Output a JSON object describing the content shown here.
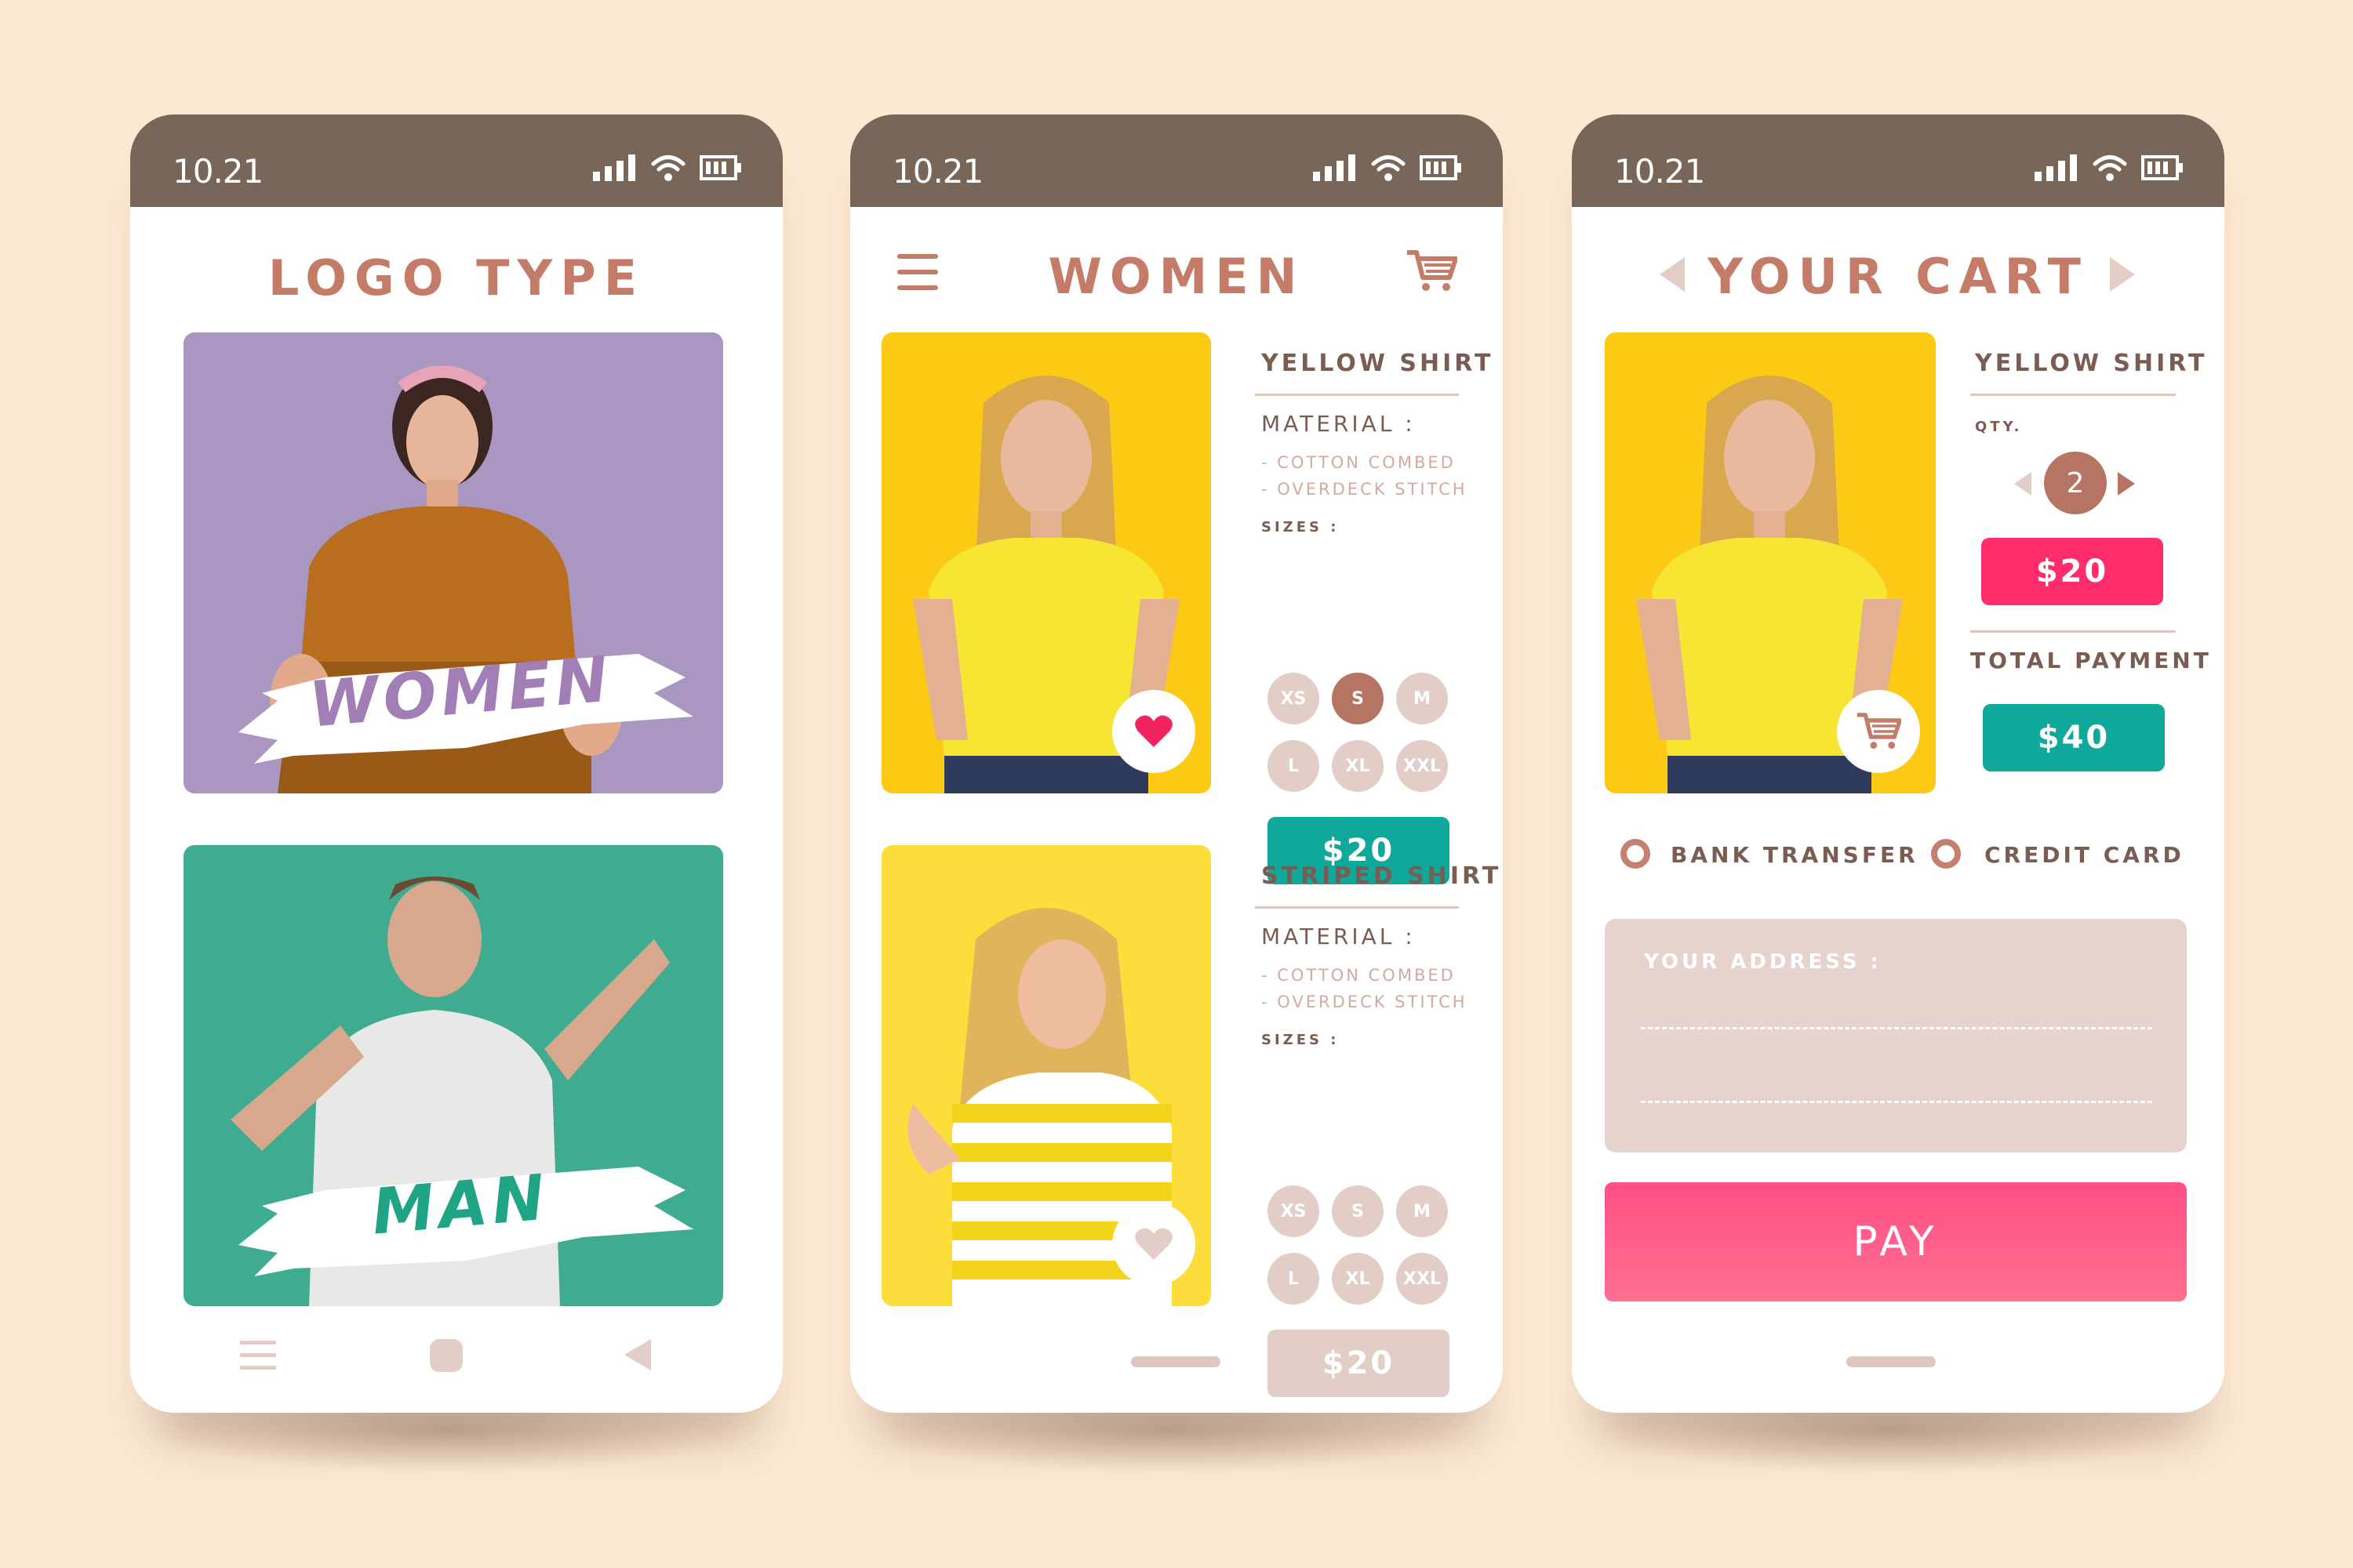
{
  "status": {
    "time": "10.21"
  },
  "screen1": {
    "title": "LOGO TYPE",
    "cards": [
      {
        "label": "WOMEN",
        "bg": "#a997c2",
        "label_color": "#a17fb6"
      },
      {
        "label": "MAN",
        "bg": "#3fab90",
        "label_color": "#1fa486"
      }
    ],
    "nav_icons": [
      "menu-icon",
      "home-icon",
      "back-icon"
    ]
  },
  "screen2": {
    "title": "WOMEN",
    "products": [
      {
        "name": "YELLOW SHIRT",
        "material_label": "MATERIAL :",
        "materials": [
          "- COTTON COMBED",
          "- OVERDECK STITCH"
        ],
        "sizes_label": "SIZES :",
        "sizes": [
          "XS",
          "S",
          "M",
          "L",
          "XL",
          "XXL"
        ],
        "selected_size": "S",
        "price": "$20",
        "favorited": true
      },
      {
        "name": "STRIPED SHIRT",
        "material_label": "MATERIAL :",
        "materials": [
          "- COTTON COMBED",
          "- OVERDECK STITCH"
        ],
        "sizes_label": "SIZES :",
        "sizes": [
          "XS",
          "S",
          "M",
          "L",
          "XL",
          "XXL"
        ],
        "selected_size": "",
        "price": "$20",
        "favorited": false
      }
    ]
  },
  "screen3": {
    "title": "YOUR CART",
    "item": {
      "name": "YELLOW SHIRT",
      "qty_label": "QTY.",
      "qty": "2",
      "price": "$20"
    },
    "total_label": "TOTAL PAYMENT",
    "total": "$40",
    "payment_options": [
      "BANK TRANSFER",
      "CREDIT CARD"
    ],
    "address_label": "YOUR ADDRESS :",
    "pay_label": "PAY"
  },
  "colors": {
    "background": "#fde8d2",
    "statusbar": "#786658",
    "title": "#c47c68",
    "teal": "#10a89a",
    "pink": "#ff2d6b",
    "pay": "#ff5e8c",
    "yellow": "#fcc915"
  }
}
